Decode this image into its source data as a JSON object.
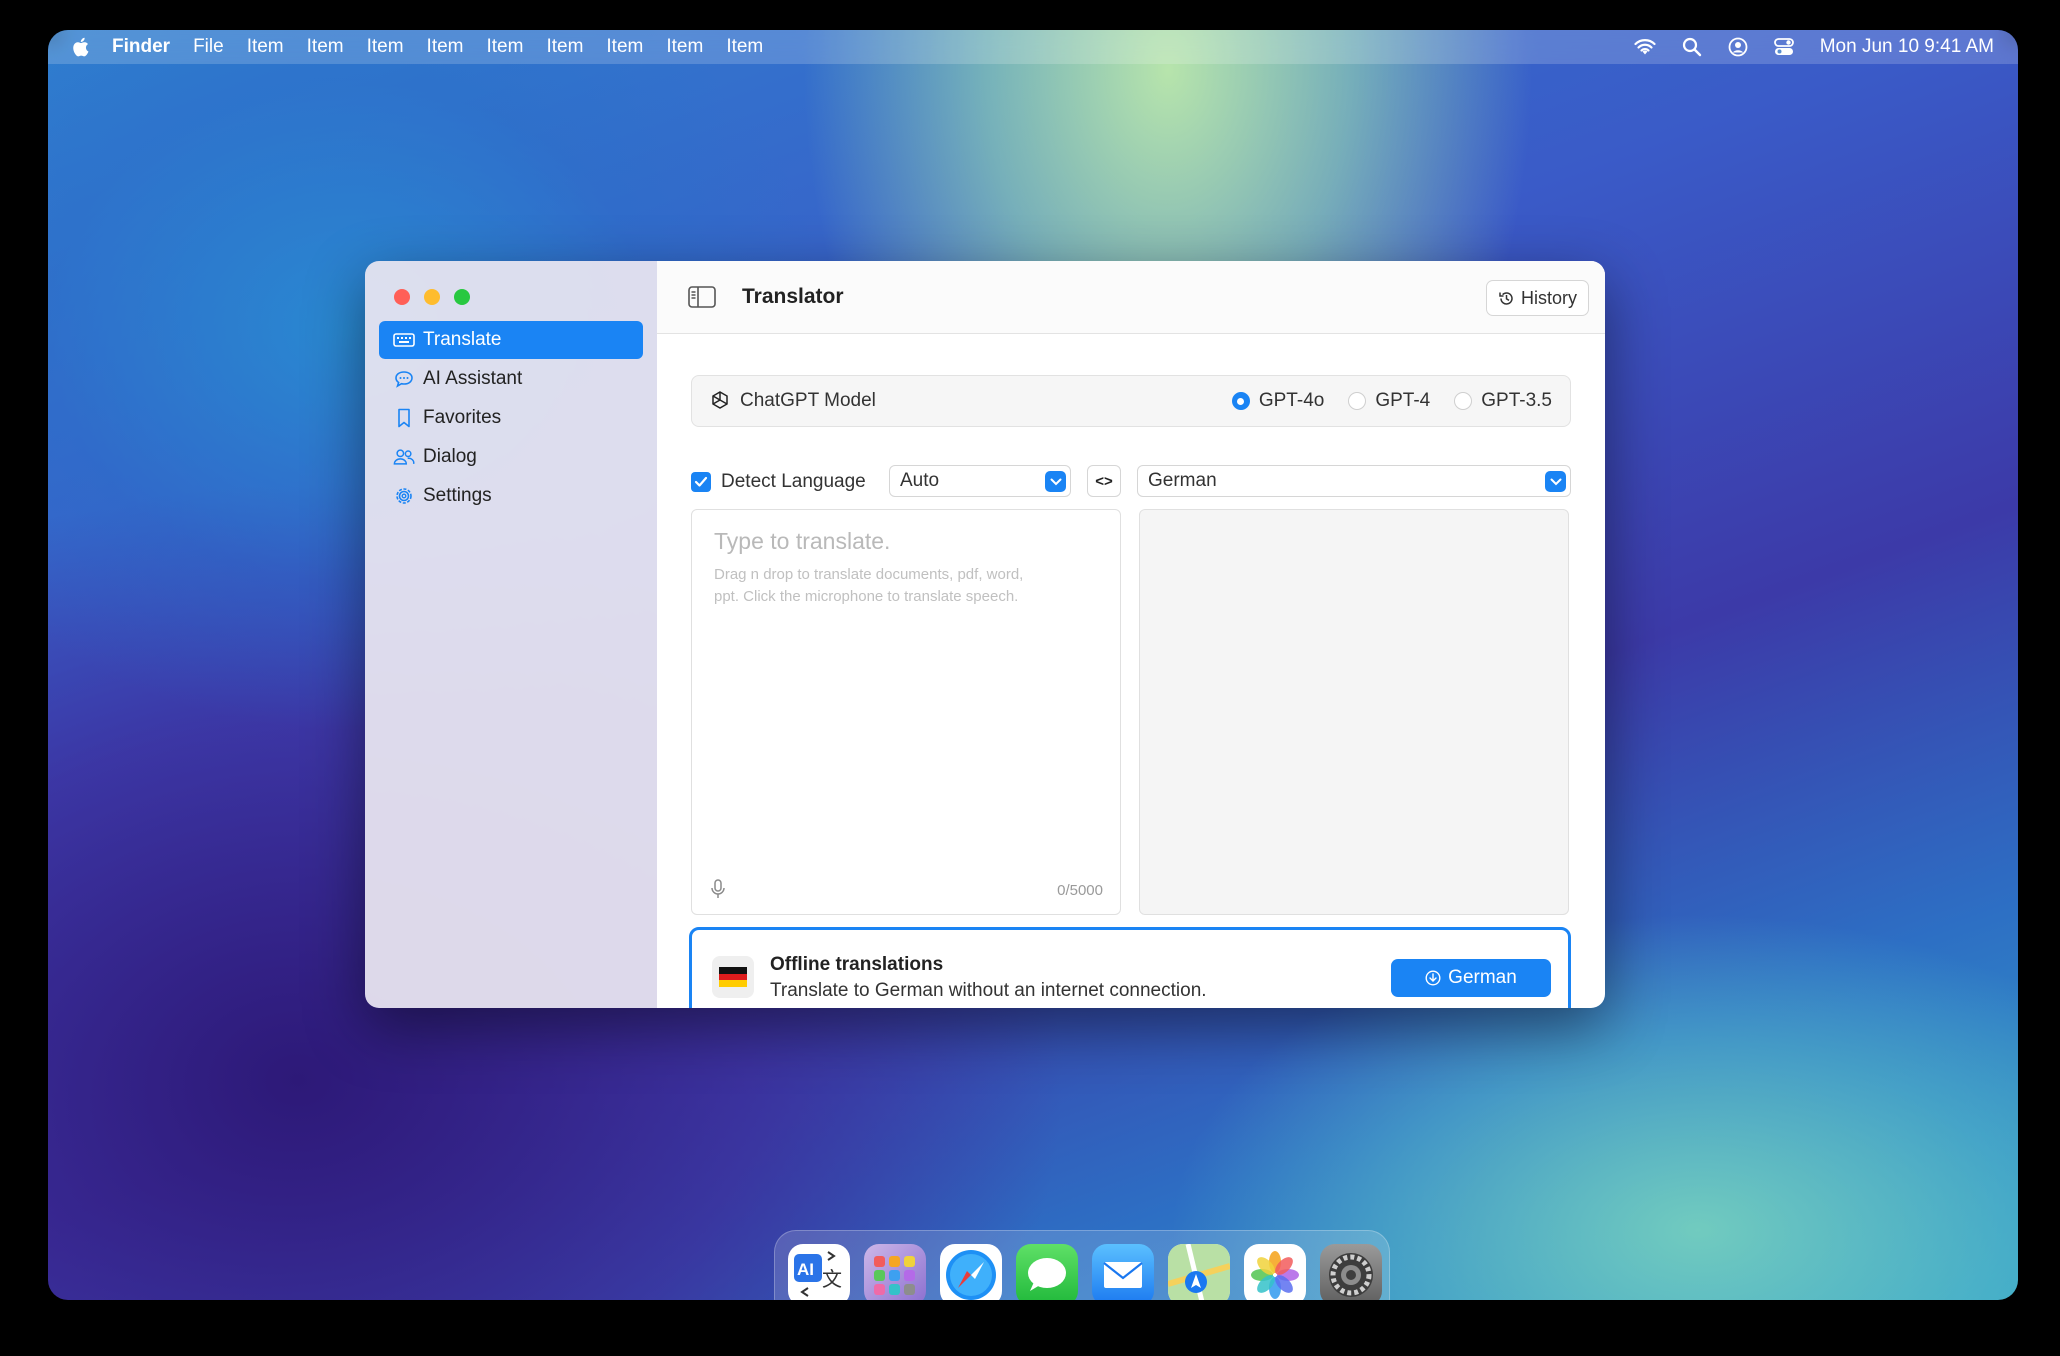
{
  "menubar": {
    "app_name": "Finder",
    "items": [
      "File",
      "Item",
      "Item",
      "Item",
      "Item",
      "Item",
      "Item",
      "Item",
      "Item",
      "Item"
    ],
    "clock": "Mon Jun 10  9:41 AM"
  },
  "window": {
    "title": "Translator",
    "history_label": "History",
    "sidebar": {
      "items": [
        {
          "label": "Translate",
          "icon": "keyboard-icon",
          "active": true
        },
        {
          "label": "AI Assistant",
          "icon": "chat-bubble-icon",
          "active": false
        },
        {
          "label": "Favorites",
          "icon": "bookmark-icon",
          "active": false
        },
        {
          "label": "Dialog",
          "icon": "people-icon",
          "active": false
        },
        {
          "label": "Settings",
          "icon": "gear-icon",
          "active": false
        }
      ]
    },
    "model": {
      "label": "ChatGPT Model",
      "options": [
        {
          "label": "GPT-4o",
          "selected": true
        },
        {
          "label": "GPT-4",
          "selected": false
        },
        {
          "label": "GPT-3.5",
          "selected": false
        }
      ]
    },
    "languages": {
      "detect_label": "Detect Language",
      "detect_checked": true,
      "source": "Auto",
      "swap_label": "<>",
      "target": "German"
    },
    "source_panel": {
      "placeholder": "Type to translate.",
      "hint": "Drag n drop to translate documents, pdf, word, ppt. Click the microphone to translate speech.",
      "char_count": "0/5000"
    },
    "offline": {
      "title": "Offline translations",
      "description": "Translate to German without an internet connection.",
      "button_label": "German"
    }
  },
  "dock": {
    "apps": [
      "translator-app",
      "launchpad",
      "safari",
      "messages",
      "mail",
      "maps",
      "photos",
      "system-settings"
    ]
  },
  "colors": {
    "accent": "#1a84f4",
    "close": "#ff5f57",
    "minimize": "#febc2e",
    "zoom": "#28c840"
  }
}
